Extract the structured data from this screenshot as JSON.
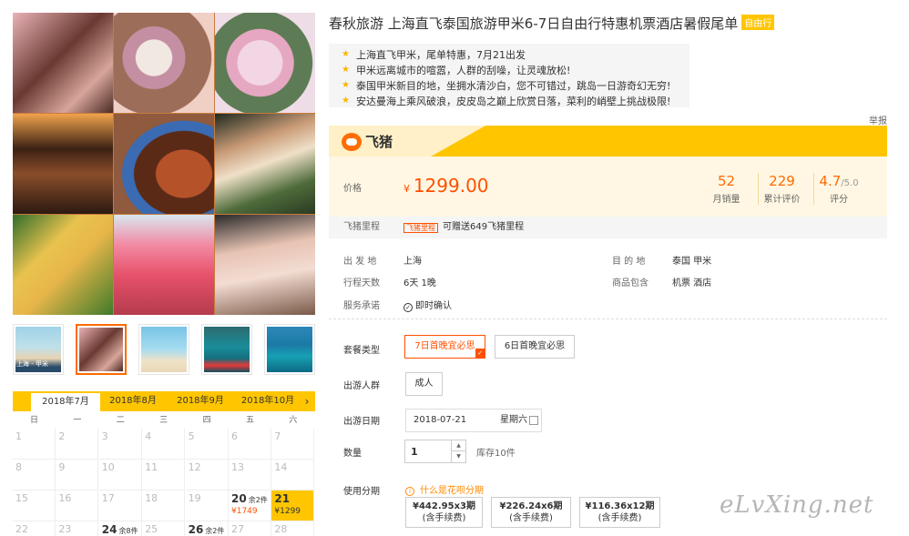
{
  "title": {
    "text": "春秋旅游 上海直飞泰国旅游甲米6-7日自由行特惠机票酒店暑假尾单",
    "tag": "自由行"
  },
  "highlights": [
    "上海直飞甲米，尾单特惠，7月21出发",
    "甲米远离城市的喧嚣，人群的刮噪，让灵魂放松!",
    "泰国甲米新目的地，坐拥水清沙白，您不可错过，跳岛一日游奇幻无穷!",
    "安达曼海上乘风破浪，皮皮岛之巅上欣赏日落，菜利的峭壁上挑战极限!"
  ],
  "report_label": "举报",
  "brand": {
    "name": "飞猪",
    "logo_icon": "fliggy-pig-icon"
  },
  "price": {
    "label": "价格",
    "currency": "¥",
    "value": "1299.00"
  },
  "stats": [
    {
      "value": "52",
      "suffix": "",
      "label": "月销量"
    },
    {
      "value": "229",
      "suffix": "",
      "label": "累计评价"
    },
    {
      "value": "4.7",
      "suffix": "/5.0",
      "label": "评分"
    }
  ],
  "mileage": {
    "label": "飞猪里程",
    "badge": "飞猪里程",
    "text": "可赠送649飞猪里程"
  },
  "info": {
    "depart_label": "出 发 地",
    "depart": "上海",
    "dest_label": "目 的 地",
    "dest": "泰国  甲米",
    "days_label": "行程天数",
    "days": "6天   1晚",
    "include_label": "商品包含",
    "include": "机票  酒店",
    "promise_label": "服务承诺",
    "promise": "即时确认"
  },
  "package": {
    "label": "套餐类型",
    "options": [
      "7日首晚宜必思",
      "6日首晚宜必思"
    ],
    "selected": 0
  },
  "people": {
    "label": "出游人群",
    "option": "成人"
  },
  "date": {
    "label": "出游日期",
    "value": "2018-07-21",
    "weekday": "星期六"
  },
  "quantity": {
    "label": "数量",
    "value": "1",
    "stock": "库存10件"
  },
  "installment": {
    "label": "使用分期",
    "help": "什么是花呗分期",
    "plans": [
      {
        "amount": "¥442.95x3期",
        "note": "(含手续费)"
      },
      {
        "amount": "¥226.24x6期",
        "note": "(含手续费)"
      },
      {
        "amount": "¥116.36x12期",
        "note": "(含手续费)"
      }
    ]
  },
  "thumb_caption": "上海 - 甲米",
  "calendar": {
    "months": [
      "2018年7月",
      "2018年8月",
      "2018年9月",
      "2018年10月"
    ],
    "active_month": 0,
    "weekdays": [
      "日",
      "一",
      "二",
      "三",
      "四",
      "五",
      "六"
    ],
    "rows": [
      [
        {
          "d": "1"
        },
        {
          "d": "2"
        },
        {
          "d": "3"
        },
        {
          "d": "4"
        },
        {
          "d": "5"
        },
        {
          "d": "6"
        },
        {
          "d": "7"
        }
      ],
      [
        {
          "d": "8"
        },
        {
          "d": "9"
        },
        {
          "d": "10"
        },
        {
          "d": "11"
        },
        {
          "d": "12"
        },
        {
          "d": "13"
        },
        {
          "d": "14"
        }
      ],
      [
        {
          "d": "15"
        },
        {
          "d": "16"
        },
        {
          "d": "17"
        },
        {
          "d": "18"
        },
        {
          "d": "19"
        },
        {
          "d": "20",
          "stock": "余2件",
          "price": "¥1749"
        },
        {
          "d": "21",
          "price": "¥1299",
          "selected": true
        }
      ],
      [
        {
          "d": "22"
        },
        {
          "d": "23"
        },
        {
          "d": "24",
          "stock": "余8件"
        },
        {
          "d": "25"
        },
        {
          "d": "26",
          "stock": "余2件"
        },
        {
          "d": "27"
        },
        {
          "d": "28"
        }
      ]
    ]
  },
  "watermark": "eLvXing.net",
  "colors": {
    "accent": "#ff5000",
    "brand_yellow": "#ffc600",
    "star": "#ffb400"
  }
}
